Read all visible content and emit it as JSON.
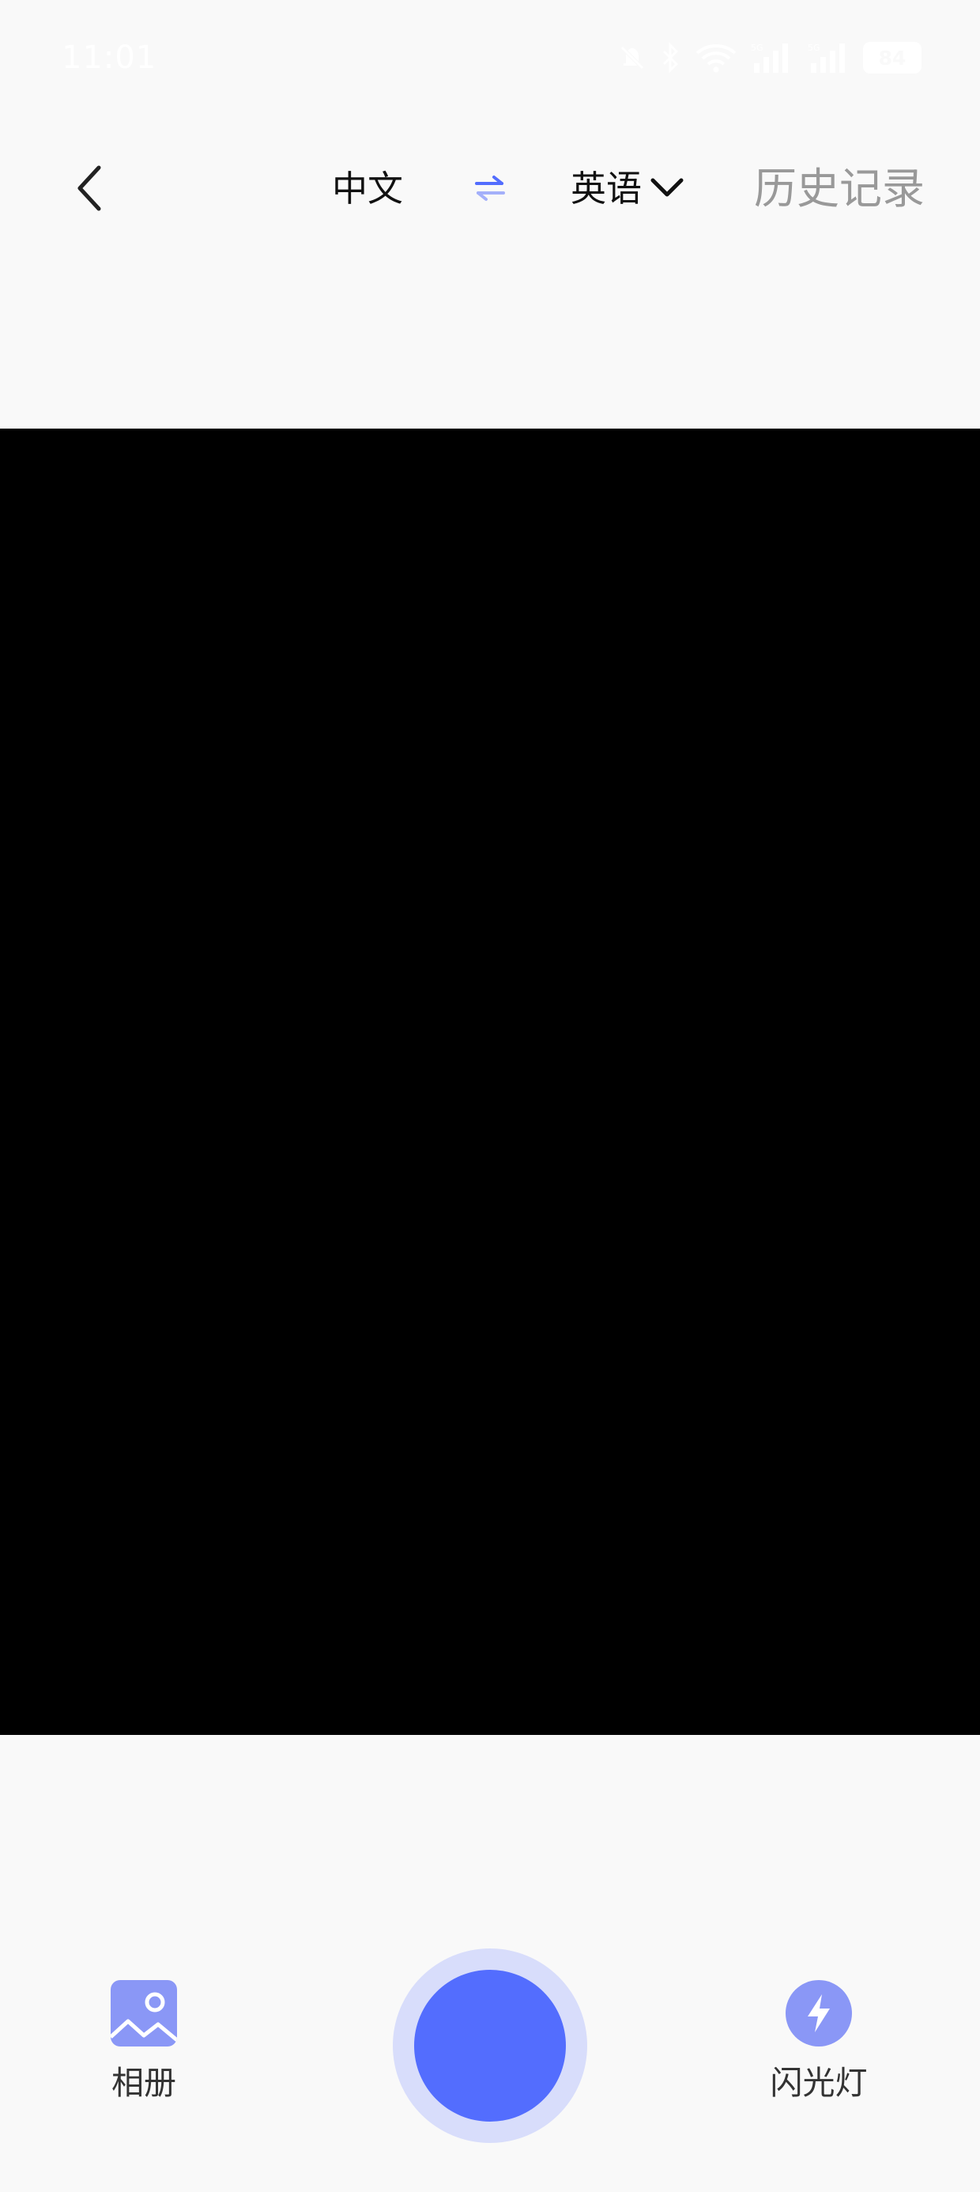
{
  "status_bar": {
    "time": "11:01",
    "battery": "84",
    "icons": [
      "mute-icon",
      "bluetooth-icon",
      "wifi-icon",
      "signal-5g-icon",
      "signal-5g-icon",
      "battery-icon"
    ]
  },
  "top_nav": {
    "back_icon": "chevron-left-icon",
    "source_language": "中文",
    "swap_icon": "swap-arrows-icon",
    "target_language": "英语",
    "target_dropdown_icon": "chevron-down-icon",
    "history_label": "历史记录"
  },
  "camera": {
    "preview_background": "#000000"
  },
  "bottom_controls": {
    "album_label": "相册",
    "album_icon": "image-icon",
    "shutter_icon": "shutter-button",
    "flash_label": "闪光灯",
    "flash_icon": "flash-icon"
  },
  "colors": {
    "accent": "#536dfe",
    "accent_light": "#8a97f6",
    "shutter_ring": "#d8ddfb",
    "background": "#f9f9f9",
    "muted_text": "#999999"
  }
}
